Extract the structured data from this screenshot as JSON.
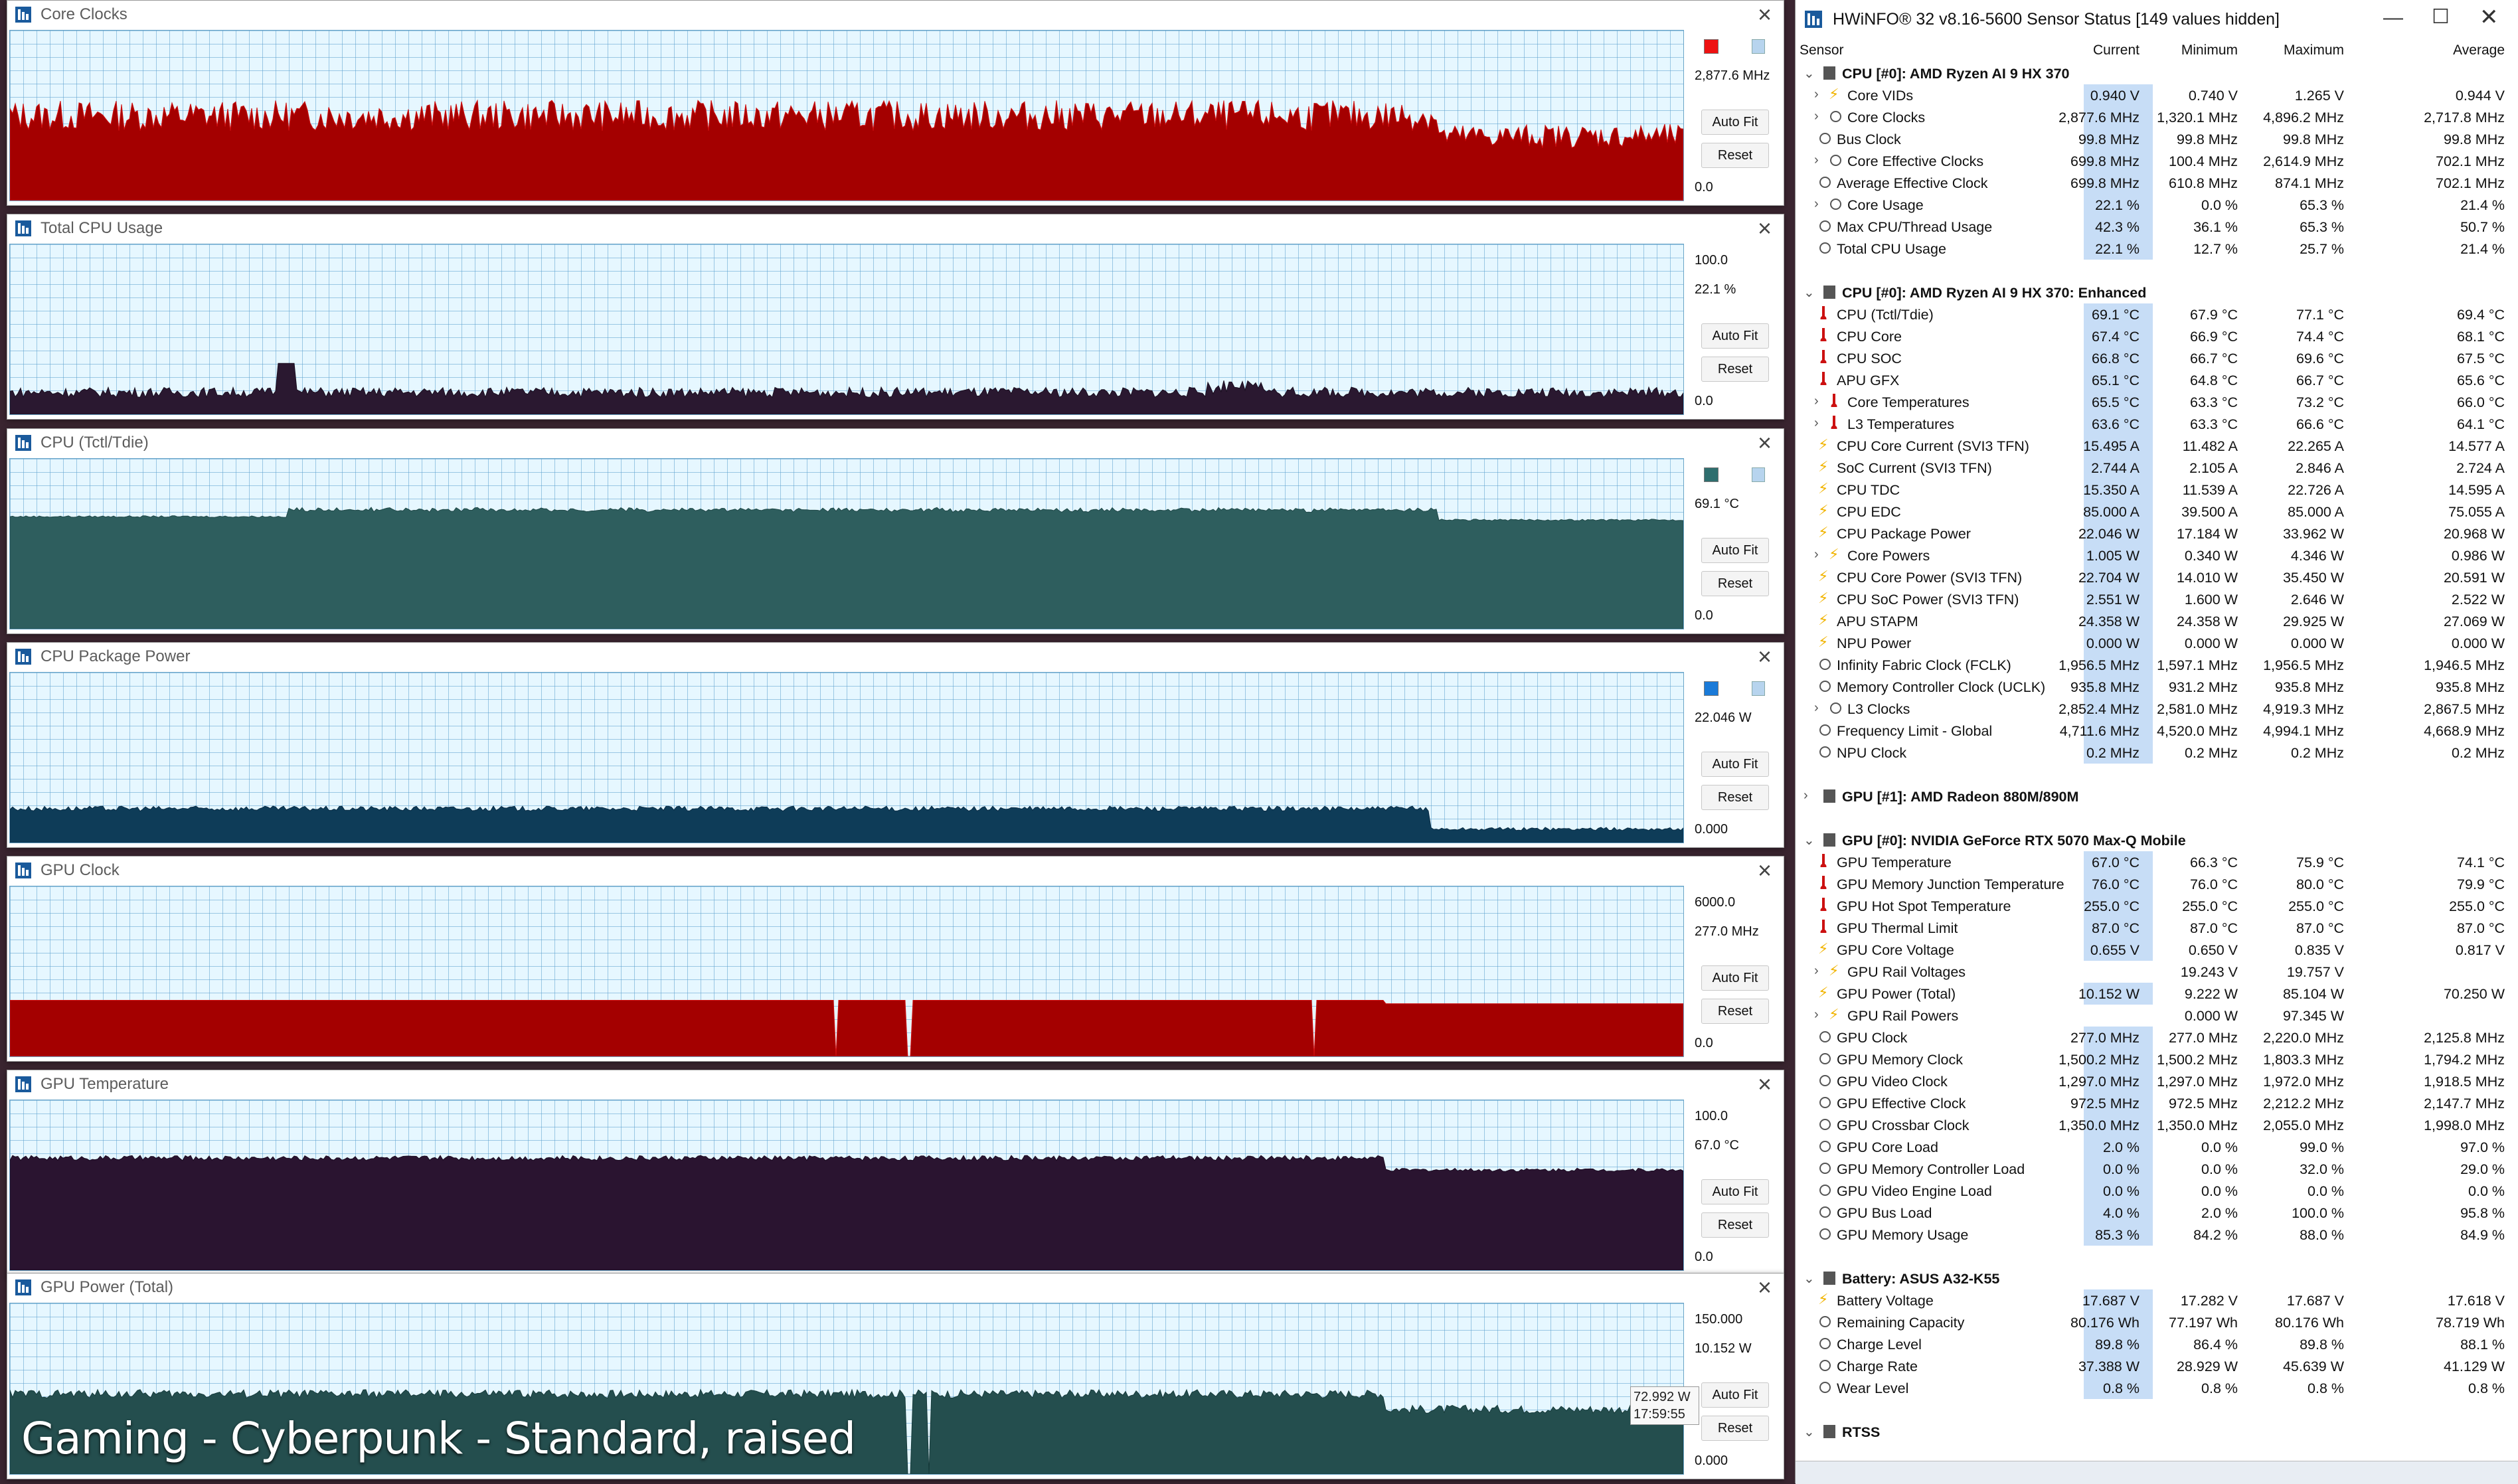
{
  "graphs": [
    {
      "title": "Core Clocks",
      "top_label": "",
      "current": "2,877.6 MHz",
      "bottom_label": "0.0",
      "fill": "#a40000",
      "stroke": "#d01010",
      "level": 0.5,
      "series": "cc",
      "swatch": "#ee1111"
    },
    {
      "title": "Total CPU Usage",
      "top_label": "100.0",
      "current": "22.1 %",
      "bottom_label": "0.0",
      "fill": "#2a1830",
      "stroke": "#1a0f20",
      "level": 0.12,
      "series": "cpu",
      "swatch": ""
    },
    {
      "title": "CPU (Tctl/Tdie)",
      "top_label": "",
      "current": "69.1 °C",
      "bottom_label": "0.0",
      "fill": "#2e5e5e",
      "stroke": "#1f4747",
      "level": 0.67,
      "series": "temp",
      "swatch": "#2e6e6e"
    },
    {
      "title": "CPU Package Power",
      "top_label": "",
      "current": "22.046 W",
      "bottom_label": "0.000",
      "fill": "#0e3c58",
      "stroke": "#0a2c44",
      "level": 0.2,
      "series": "pwr",
      "swatch": "#1a7ad8"
    },
    {
      "title": "GPU Clock",
      "top_label": "6000.0",
      "current": "277.0 MHz",
      "bottom_label": "0.0",
      "fill": "#a40000",
      "stroke": "#d01010",
      "level": 0.33,
      "series": "gclk",
      "swatch": ""
    },
    {
      "title": "GPU Temperature",
      "top_label": "100.0",
      "current": "67.0 °C",
      "bottom_label": "0.0",
      "fill": "#2a1430",
      "stroke": "#1a0a20",
      "level": 0.67,
      "series": "gtemp",
      "swatch": ""
    },
    {
      "title": "GPU Power (Total)",
      "top_label": "150.000",
      "current": "10.152 W",
      "bottom_label": "0.000",
      "fill": "#244e4e",
      "stroke": "#163a3a",
      "level": 0.45,
      "series": "gpwr",
      "swatch": ""
    }
  ],
  "buttons": {
    "autofit": "Auto Fit",
    "reset": "Reset"
  },
  "swatch_text": "0",
  "watermark": "Gaming - Cyberpunk - Standard, raised",
  "tooltip": {
    "value": "72.992 W",
    "time": "17:59:55"
  },
  "sensor": {
    "title": "HWiNFO® 32 v8.16-5600 Sensor Status [149 values hidden]",
    "headers": {
      "sensor": "Sensor",
      "current": "Current",
      "minimum": "Minimum",
      "maximum": "Maximum",
      "average": "Average"
    },
    "rows": [
      {
        "t": "g",
        "label": "CPU [#0]: AMD Ryzen AI 9 HX 370",
        "exp": "v"
      },
      {
        "t": "r",
        "label": "Core VIDs",
        "icon": "bolt",
        "ind": 1,
        "exp": ">",
        "cur": "0.940 V",
        "min": "0.740 V",
        "max": "1.265 V",
        "avg": "0.944 V"
      },
      {
        "t": "r",
        "label": "Core Clocks",
        "icon": "clock",
        "ind": 1,
        "exp": ">",
        "cur": "2,877.6 MHz",
        "min": "1,320.1 MHz",
        "max": "4,896.2 MHz",
        "avg": "2,717.8 MHz"
      },
      {
        "t": "r",
        "label": "Bus Clock",
        "icon": "clock",
        "ind": 0,
        "cur": "99.8 MHz",
        "min": "99.8 MHz",
        "max": "99.8 MHz",
        "avg": "99.8 MHz"
      },
      {
        "t": "r",
        "label": "Core Effective Clocks",
        "icon": "clock",
        "ind": 1,
        "exp": ">",
        "cur": "699.8 MHz",
        "min": "100.4 MHz",
        "max": "2,614.9 MHz",
        "avg": "702.1 MHz"
      },
      {
        "t": "r",
        "label": "Average Effective Clock",
        "icon": "clock",
        "ind": 0,
        "cur": "699.8 MHz",
        "min": "610.8 MHz",
        "max": "874.1 MHz",
        "avg": "702.1 MHz"
      },
      {
        "t": "r",
        "label": "Core Usage",
        "icon": "clock",
        "ind": 1,
        "exp": ">",
        "cur": "22.1 %",
        "min": "0.0 %",
        "max": "65.3 %",
        "avg": "21.4 %"
      },
      {
        "t": "r",
        "label": "Max CPU/Thread Usage",
        "icon": "clock",
        "ind": 0,
        "cur": "42.3 %",
        "min": "36.1 %",
        "max": "65.3 %",
        "avg": "50.7 %"
      },
      {
        "t": "r",
        "label": "Total CPU Usage",
        "icon": "clock",
        "ind": 0,
        "cur": "22.1 %",
        "min": "12.7 %",
        "max": "25.7 %",
        "avg": "21.4 %"
      },
      {
        "t": "s"
      },
      {
        "t": "g",
        "label": "CPU [#0]: AMD Ryzen AI 9 HX 370: Enhanced",
        "exp": "v"
      },
      {
        "t": "r",
        "label": "CPU (Tctl/Tdie)",
        "icon": "therm",
        "ind": 0,
        "cur": "69.1 °C",
        "min": "67.9 °C",
        "max": "77.1 °C",
        "avg": "69.4 °C"
      },
      {
        "t": "r",
        "label": "CPU Core",
        "icon": "therm",
        "ind": 0,
        "cur": "67.4 °C",
        "min": "66.9 °C",
        "max": "74.4 °C",
        "avg": "68.1 °C"
      },
      {
        "t": "r",
        "label": "CPU SOC",
        "icon": "therm",
        "ind": 0,
        "cur": "66.8 °C",
        "min": "66.7 °C",
        "max": "69.6 °C",
        "avg": "67.5 °C"
      },
      {
        "t": "r",
        "label": "APU GFX",
        "icon": "therm",
        "ind": 0,
        "cur": "65.1 °C",
        "min": "64.8 °C",
        "max": "66.7 °C",
        "avg": "65.6 °C"
      },
      {
        "t": "r",
        "label": "Core Temperatures",
        "icon": "therm",
        "ind": 1,
        "exp": ">",
        "cur": "65.5 °C",
        "min": "63.3 °C",
        "max": "73.2 °C",
        "avg": "66.0 °C"
      },
      {
        "t": "r",
        "label": "L3 Temperatures",
        "icon": "therm",
        "ind": 1,
        "exp": ">",
        "cur": "63.6 °C",
        "min": "63.3 °C",
        "max": "66.6 °C",
        "avg": "64.1 °C"
      },
      {
        "t": "r",
        "label": "CPU Core Current (SVI3 TFN)",
        "icon": "bolt",
        "ind": 0,
        "cur": "15.495 A",
        "min": "11.482 A",
        "max": "22.265 A",
        "avg": "14.577 A"
      },
      {
        "t": "r",
        "label": "SoC Current (SVI3 TFN)",
        "icon": "bolt",
        "ind": 0,
        "cur": "2.744 A",
        "min": "2.105 A",
        "max": "2.846 A",
        "avg": "2.724 A"
      },
      {
        "t": "r",
        "label": "CPU TDC",
        "icon": "bolt",
        "ind": 0,
        "cur": "15.350 A",
        "min": "11.539 A",
        "max": "22.726 A",
        "avg": "14.595 A"
      },
      {
        "t": "r",
        "label": "CPU EDC",
        "icon": "bolt",
        "ind": 0,
        "cur": "85.000 A",
        "min": "39.500 A",
        "max": "85.000 A",
        "avg": "75.055 A"
      },
      {
        "t": "r",
        "label": "CPU Package Power",
        "icon": "bolt",
        "ind": 0,
        "cur": "22.046 W",
        "min": "17.184 W",
        "max": "33.962 W",
        "avg": "20.968 W"
      },
      {
        "t": "r",
        "label": "Core Powers",
        "icon": "bolt",
        "ind": 1,
        "exp": ">",
        "cur": "1.005 W",
        "min": "0.340 W",
        "max": "4.346 W",
        "avg": "0.986 W"
      },
      {
        "t": "r",
        "label": "CPU Core Power (SVI3 TFN)",
        "icon": "bolt",
        "ind": 0,
        "cur": "22.704 W",
        "min": "14.010 W",
        "max": "35.450 W",
        "avg": "20.591 W"
      },
      {
        "t": "r",
        "label": "CPU SoC Power (SVI3 TFN)",
        "icon": "bolt",
        "ind": 0,
        "cur": "2.551 W",
        "min": "1.600 W",
        "max": "2.646 W",
        "avg": "2.522 W"
      },
      {
        "t": "r",
        "label": "APU STAPM",
        "icon": "bolt",
        "ind": 0,
        "cur": "24.358 W",
        "min": "24.358 W",
        "max": "29.925 W",
        "avg": "27.069 W"
      },
      {
        "t": "r",
        "label": "NPU Power",
        "icon": "bolt",
        "ind": 0,
        "cur": "0.000 W",
        "min": "0.000 W",
        "max": "0.000 W",
        "avg": "0.000 W"
      },
      {
        "t": "r",
        "label": "Infinity Fabric Clock (FCLK)",
        "icon": "clock",
        "ind": 0,
        "cur": "1,956.5 MHz",
        "min": "1,597.1 MHz",
        "max": "1,956.5 MHz",
        "avg": "1,946.5 MHz"
      },
      {
        "t": "r",
        "label": "Memory Controller Clock (UCLK)",
        "icon": "clock",
        "ind": 0,
        "cur": "935.8 MHz",
        "min": "931.2 MHz",
        "max": "935.8 MHz",
        "avg": "935.8 MHz"
      },
      {
        "t": "r",
        "label": "L3 Clocks",
        "icon": "clock",
        "ind": 1,
        "exp": ">",
        "cur": "2,852.4 MHz",
        "min": "2,581.0 MHz",
        "max": "4,919.3 MHz",
        "avg": "2,867.5 MHz"
      },
      {
        "t": "r",
        "label": "Frequency Limit - Global",
        "icon": "clock",
        "ind": 0,
        "cur": "4,711.6 MHz",
        "min": "4,520.0 MHz",
        "max": "4,994.1 MHz",
        "avg": "4,668.9 MHz"
      },
      {
        "t": "r",
        "label": "NPU Clock",
        "icon": "clock",
        "ind": 0,
        "cur": "0.2 MHz",
        "min": "0.2 MHz",
        "max": "0.2 MHz",
        "avg": "0.2 MHz"
      },
      {
        "t": "s"
      },
      {
        "t": "g",
        "label": "GPU [#1]: AMD Radeon 880M/890M",
        "exp": ">"
      },
      {
        "t": "s"
      },
      {
        "t": "g",
        "label": "GPU [#0]: NVIDIA  GeForce RTX 5070 Max-Q Mobile",
        "exp": "v"
      },
      {
        "t": "r",
        "label": "GPU Temperature",
        "icon": "therm",
        "ind": 0,
        "cur": "67.0 °C",
        "min": "66.3 °C",
        "max": "75.9 °C",
        "avg": "74.1 °C"
      },
      {
        "t": "r",
        "label": "GPU Memory Junction Temperature",
        "icon": "therm",
        "ind": 0,
        "cur": "76.0 °C",
        "min": "76.0 °C",
        "max": "80.0 °C",
        "avg": "79.9 °C"
      },
      {
        "t": "r",
        "label": "GPU Hot Spot Temperature",
        "icon": "therm",
        "ind": 0,
        "cur": "255.0 °C",
        "min": "255.0 °C",
        "max": "255.0 °C",
        "avg": "255.0 °C"
      },
      {
        "t": "r",
        "label": "GPU Thermal Limit",
        "icon": "therm",
        "ind": 0,
        "cur": "87.0 °C",
        "min": "87.0 °C",
        "max": "87.0 °C",
        "avg": "87.0 °C"
      },
      {
        "t": "r",
        "label": "GPU Core Voltage",
        "icon": "bolt",
        "ind": 0,
        "cur": "0.655 V",
        "min": "0.650 V",
        "max": "0.835 V",
        "avg": "0.817 V"
      },
      {
        "t": "r",
        "label": "GPU Rail Voltages",
        "icon": "bolt",
        "ind": 1,
        "exp": ">",
        "cur": "",
        "min": "19.243 V",
        "max": "19.757 V",
        "avg": ""
      },
      {
        "t": "r",
        "label": "GPU Power (Total)",
        "icon": "bolt",
        "ind": 0,
        "cur": "10.152 W",
        "min": "9.222 W",
        "max": "85.104 W",
        "avg": "70.250 W"
      },
      {
        "t": "r",
        "label": "GPU Rail Powers",
        "icon": "bolt",
        "ind": 1,
        "exp": ">",
        "cur": "",
        "min": "0.000 W",
        "max": "97.345 W",
        "avg": ""
      },
      {
        "t": "r",
        "label": "GPU Clock",
        "icon": "clock",
        "ind": 0,
        "cur": "277.0 MHz",
        "min": "277.0 MHz",
        "max": "2,220.0 MHz",
        "avg": "2,125.8 MHz"
      },
      {
        "t": "r",
        "label": "GPU Memory Clock",
        "icon": "clock",
        "ind": 0,
        "cur": "1,500.2 MHz",
        "min": "1,500.2 MHz",
        "max": "1,803.3 MHz",
        "avg": "1,794.2 MHz"
      },
      {
        "t": "r",
        "label": "GPU Video Clock",
        "icon": "clock",
        "ind": 0,
        "cur": "1,297.0 MHz",
        "min": "1,297.0 MHz",
        "max": "1,972.0 MHz",
        "avg": "1,918.5 MHz"
      },
      {
        "t": "r",
        "label": "GPU Effective Clock",
        "icon": "clock",
        "ind": 0,
        "cur": "972.5 MHz",
        "min": "972.5 MHz",
        "max": "2,212.2 MHz",
        "avg": "2,147.7 MHz"
      },
      {
        "t": "r",
        "label": "GPU Crossbar Clock",
        "icon": "clock",
        "ind": 0,
        "cur": "1,350.0 MHz",
        "min": "1,350.0 MHz",
        "max": "2,055.0 MHz",
        "avg": "1,998.0 MHz"
      },
      {
        "t": "r",
        "label": "GPU Core Load",
        "icon": "clock",
        "ind": 0,
        "cur": "2.0 %",
        "min": "0.0 %",
        "max": "99.0 %",
        "avg": "97.0 %"
      },
      {
        "t": "r",
        "label": "GPU Memory Controller Load",
        "icon": "clock",
        "ind": 0,
        "cur": "0.0 %",
        "min": "0.0 %",
        "max": "32.0 %",
        "avg": "29.0 %"
      },
      {
        "t": "r",
        "label": "GPU Video Engine Load",
        "icon": "clock",
        "ind": 0,
        "cur": "0.0 %",
        "min": "0.0 %",
        "max": "0.0 %",
        "avg": "0.0 %"
      },
      {
        "t": "r",
        "label": "GPU Bus Load",
        "icon": "clock",
        "ind": 0,
        "cur": "4.0 %",
        "min": "2.0 %",
        "max": "100.0 %",
        "avg": "95.8 %"
      },
      {
        "t": "r",
        "label": "GPU Memory Usage",
        "icon": "clock",
        "ind": 0,
        "cur": "85.3 %",
        "min": "84.2 %",
        "max": "88.0 %",
        "avg": "84.9 %"
      },
      {
        "t": "s"
      },
      {
        "t": "g",
        "label": "Battery: ASUS  A32-K55",
        "exp": "v"
      },
      {
        "t": "r",
        "label": "Battery Voltage",
        "icon": "bolt",
        "ind": 0,
        "cur": "17.687 V",
        "min": "17.282 V",
        "max": "17.687 V",
        "avg": "17.618 V"
      },
      {
        "t": "r",
        "label": "Remaining Capacity",
        "icon": "clock",
        "ind": 0,
        "cur": "80.176 Wh",
        "min": "77.197 Wh",
        "max": "80.176 Wh",
        "avg": "78.719 Wh"
      },
      {
        "t": "r",
        "label": "Charge Level",
        "icon": "clock",
        "ind": 0,
        "cur": "89.8 %",
        "min": "86.4 %",
        "max": "89.8 %",
        "avg": "88.1 %"
      },
      {
        "t": "r",
        "label": "Charge Rate",
        "icon": "clock",
        "ind": 0,
        "cur": "37.388 W",
        "min": "28.929 W",
        "max": "45.639 W",
        "avg": "41.129 W"
      },
      {
        "t": "r",
        "label": "Wear Level",
        "icon": "clock",
        "ind": 0,
        "cur": "0.8 %",
        "min": "0.8 %",
        "max": "0.8 %",
        "avg": "0.8 %"
      },
      {
        "t": "s"
      },
      {
        "t": "g",
        "label": "RTSS",
        "exp": "v"
      }
    ]
  }
}
